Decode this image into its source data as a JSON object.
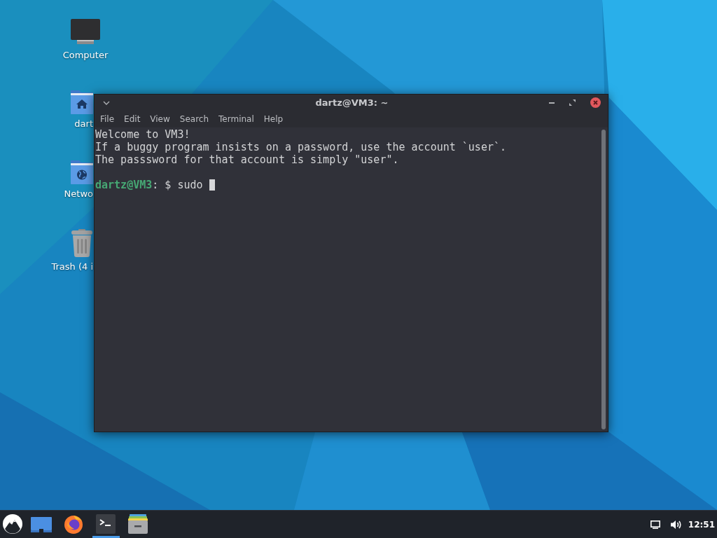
{
  "desktop_icons": [
    {
      "kind": "computer",
      "label": "Computer"
    },
    {
      "kind": "home-folder",
      "label": "dart"
    },
    {
      "kind": "network-folder",
      "label": "Netwo"
    },
    {
      "kind": "trash",
      "label": "Trash (4 i"
    }
  ],
  "terminal_window": {
    "title": "dartz@VM3: ~",
    "menu": [
      "File",
      "Edit",
      "View",
      "Search",
      "Terminal",
      "Help"
    ],
    "output": [
      "Welcome to VM3!",
      "If a buggy program insists on a password, use the account `user`.",
      "The passsword for that account is simply \"user\"."
    ],
    "prompt": {
      "user_host": "dartz@VM3",
      "text": ": $ sudo"
    }
  },
  "taskbar": {
    "items": [
      {
        "kind": "menu",
        "active": false
      },
      {
        "kind": "show-desktop",
        "active": false
      },
      {
        "kind": "firefox",
        "active": false
      },
      {
        "kind": "terminal",
        "active": true
      },
      {
        "kind": "files",
        "active": false
      }
    ],
    "tray": [
      {
        "kind": "display"
      },
      {
        "kind": "volume"
      }
    ],
    "clock": "12:51"
  }
}
